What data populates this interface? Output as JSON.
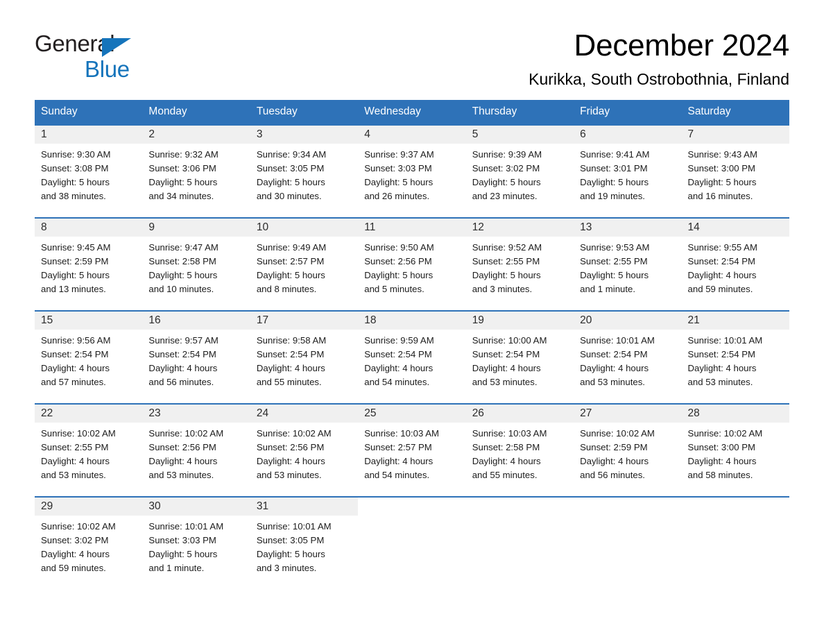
{
  "brand": {
    "name_part1": "General",
    "name_part2": "Blue",
    "triangle_color": "#1574bb",
    "logo_icon": "triangle-logo-icon"
  },
  "header": {
    "month_title": "December 2024",
    "location": "Kurikka, South Ostrobothnia, Finland"
  },
  "calendar": {
    "accent_color": "#2e72b8",
    "daynum_background": "#f0f0f0",
    "weekday_headers": [
      "Sunday",
      "Monday",
      "Tuesday",
      "Wednesday",
      "Thursday",
      "Friday",
      "Saturday"
    ],
    "weeks": [
      [
        {
          "day": "1",
          "sunrise": "Sunrise: 9:30 AM",
          "sunset": "Sunset: 3:08 PM",
          "daylight_line1": "Daylight: 5 hours",
          "daylight_line2": "and 38 minutes."
        },
        {
          "day": "2",
          "sunrise": "Sunrise: 9:32 AM",
          "sunset": "Sunset: 3:06 PM",
          "daylight_line1": "Daylight: 5 hours",
          "daylight_line2": "and 34 minutes."
        },
        {
          "day": "3",
          "sunrise": "Sunrise: 9:34 AM",
          "sunset": "Sunset: 3:05 PM",
          "daylight_line1": "Daylight: 5 hours",
          "daylight_line2": "and 30 minutes."
        },
        {
          "day": "4",
          "sunrise": "Sunrise: 9:37 AM",
          "sunset": "Sunset: 3:03 PM",
          "daylight_line1": "Daylight: 5 hours",
          "daylight_line2": "and 26 minutes."
        },
        {
          "day": "5",
          "sunrise": "Sunrise: 9:39 AM",
          "sunset": "Sunset: 3:02 PM",
          "daylight_line1": "Daylight: 5 hours",
          "daylight_line2": "and 23 minutes."
        },
        {
          "day": "6",
          "sunrise": "Sunrise: 9:41 AM",
          "sunset": "Sunset: 3:01 PM",
          "daylight_line1": "Daylight: 5 hours",
          "daylight_line2": "and 19 minutes."
        },
        {
          "day": "7",
          "sunrise": "Sunrise: 9:43 AM",
          "sunset": "Sunset: 3:00 PM",
          "daylight_line1": "Daylight: 5 hours",
          "daylight_line2": "and 16 minutes."
        }
      ],
      [
        {
          "day": "8",
          "sunrise": "Sunrise: 9:45 AM",
          "sunset": "Sunset: 2:59 PM",
          "daylight_line1": "Daylight: 5 hours",
          "daylight_line2": "and 13 minutes."
        },
        {
          "day": "9",
          "sunrise": "Sunrise: 9:47 AM",
          "sunset": "Sunset: 2:58 PM",
          "daylight_line1": "Daylight: 5 hours",
          "daylight_line2": "and 10 minutes."
        },
        {
          "day": "10",
          "sunrise": "Sunrise: 9:49 AM",
          "sunset": "Sunset: 2:57 PM",
          "daylight_line1": "Daylight: 5 hours",
          "daylight_line2": "and 8 minutes."
        },
        {
          "day": "11",
          "sunrise": "Sunrise: 9:50 AM",
          "sunset": "Sunset: 2:56 PM",
          "daylight_line1": "Daylight: 5 hours",
          "daylight_line2": "and 5 minutes."
        },
        {
          "day": "12",
          "sunrise": "Sunrise: 9:52 AM",
          "sunset": "Sunset: 2:55 PM",
          "daylight_line1": "Daylight: 5 hours",
          "daylight_line2": "and 3 minutes."
        },
        {
          "day": "13",
          "sunrise": "Sunrise: 9:53 AM",
          "sunset": "Sunset: 2:55 PM",
          "daylight_line1": "Daylight: 5 hours",
          "daylight_line2": "and 1 minute."
        },
        {
          "day": "14",
          "sunrise": "Sunrise: 9:55 AM",
          "sunset": "Sunset: 2:54 PM",
          "daylight_line1": "Daylight: 4 hours",
          "daylight_line2": "and 59 minutes."
        }
      ],
      [
        {
          "day": "15",
          "sunrise": "Sunrise: 9:56 AM",
          "sunset": "Sunset: 2:54 PM",
          "daylight_line1": "Daylight: 4 hours",
          "daylight_line2": "and 57 minutes."
        },
        {
          "day": "16",
          "sunrise": "Sunrise: 9:57 AM",
          "sunset": "Sunset: 2:54 PM",
          "daylight_line1": "Daylight: 4 hours",
          "daylight_line2": "and 56 minutes."
        },
        {
          "day": "17",
          "sunrise": "Sunrise: 9:58 AM",
          "sunset": "Sunset: 2:54 PM",
          "daylight_line1": "Daylight: 4 hours",
          "daylight_line2": "and 55 minutes."
        },
        {
          "day": "18",
          "sunrise": "Sunrise: 9:59 AM",
          "sunset": "Sunset: 2:54 PM",
          "daylight_line1": "Daylight: 4 hours",
          "daylight_line2": "and 54 minutes."
        },
        {
          "day": "19",
          "sunrise": "Sunrise: 10:00 AM",
          "sunset": "Sunset: 2:54 PM",
          "daylight_line1": "Daylight: 4 hours",
          "daylight_line2": "and 53 minutes."
        },
        {
          "day": "20",
          "sunrise": "Sunrise: 10:01 AM",
          "sunset": "Sunset: 2:54 PM",
          "daylight_line1": "Daylight: 4 hours",
          "daylight_line2": "and 53 minutes."
        },
        {
          "day": "21",
          "sunrise": "Sunrise: 10:01 AM",
          "sunset": "Sunset: 2:54 PM",
          "daylight_line1": "Daylight: 4 hours",
          "daylight_line2": "and 53 minutes."
        }
      ],
      [
        {
          "day": "22",
          "sunrise": "Sunrise: 10:02 AM",
          "sunset": "Sunset: 2:55 PM",
          "daylight_line1": "Daylight: 4 hours",
          "daylight_line2": "and 53 minutes."
        },
        {
          "day": "23",
          "sunrise": "Sunrise: 10:02 AM",
          "sunset": "Sunset: 2:56 PM",
          "daylight_line1": "Daylight: 4 hours",
          "daylight_line2": "and 53 minutes."
        },
        {
          "day": "24",
          "sunrise": "Sunrise: 10:02 AM",
          "sunset": "Sunset: 2:56 PM",
          "daylight_line1": "Daylight: 4 hours",
          "daylight_line2": "and 53 minutes."
        },
        {
          "day": "25",
          "sunrise": "Sunrise: 10:03 AM",
          "sunset": "Sunset: 2:57 PM",
          "daylight_line1": "Daylight: 4 hours",
          "daylight_line2": "and 54 minutes."
        },
        {
          "day": "26",
          "sunrise": "Sunrise: 10:03 AM",
          "sunset": "Sunset: 2:58 PM",
          "daylight_line1": "Daylight: 4 hours",
          "daylight_line2": "and 55 minutes."
        },
        {
          "day": "27",
          "sunrise": "Sunrise: 10:02 AM",
          "sunset": "Sunset: 2:59 PM",
          "daylight_line1": "Daylight: 4 hours",
          "daylight_line2": "and 56 minutes."
        },
        {
          "day": "28",
          "sunrise": "Sunrise: 10:02 AM",
          "sunset": "Sunset: 3:00 PM",
          "daylight_line1": "Daylight: 4 hours",
          "daylight_line2": "and 58 minutes."
        }
      ],
      [
        {
          "day": "29",
          "sunrise": "Sunrise: 10:02 AM",
          "sunset": "Sunset: 3:02 PM",
          "daylight_line1": "Daylight: 4 hours",
          "daylight_line2": "and 59 minutes."
        },
        {
          "day": "30",
          "sunrise": "Sunrise: 10:01 AM",
          "sunset": "Sunset: 3:03 PM",
          "daylight_line1": "Daylight: 5 hours",
          "daylight_line2": "and 1 minute."
        },
        {
          "day": "31",
          "sunrise": "Sunrise: 10:01 AM",
          "sunset": "Sunset: 3:05 PM",
          "daylight_line1": "Daylight: 5 hours",
          "daylight_line2": "and 3 minutes."
        },
        null,
        null,
        null,
        null
      ]
    ]
  }
}
